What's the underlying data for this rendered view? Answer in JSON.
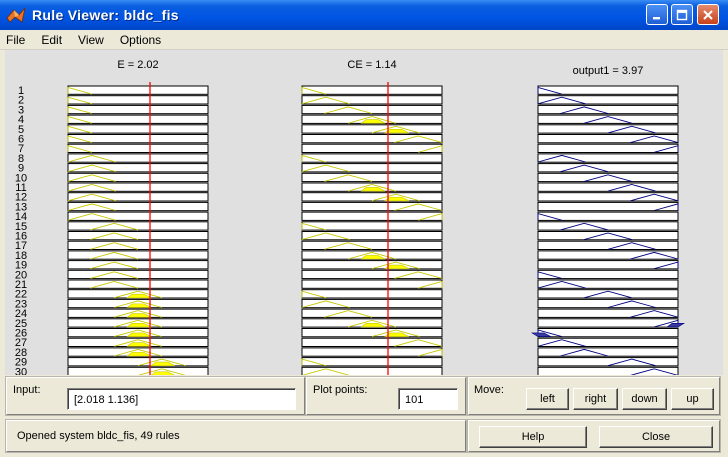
{
  "window": {
    "title": "Rule Viewer: bldc_fis"
  },
  "menu": [
    "File",
    "Edit",
    "View",
    "Options"
  ],
  "plots": {
    "input1_label": "E = 2.02",
    "input2_label": "CE = 1.14",
    "output_label": "output1 = 3.97",
    "rule_numbers": [
      "1",
      "2",
      "3",
      "4",
      "5",
      "6",
      "7",
      "8",
      "9",
      "10",
      "11",
      "12",
      "13",
      "14",
      "15",
      "16",
      "17",
      "18",
      "19",
      "20",
      "21",
      "22",
      "23",
      "24",
      "25",
      "26",
      "27",
      "28",
      "29",
      "30"
    ]
  },
  "input_panel": {
    "label": "Input:",
    "value": "[2.018 1.136]"
  },
  "plot_points": {
    "label": "Plot points:",
    "value": "101"
  },
  "move": {
    "label": "Move:",
    "left": "left",
    "right": "right",
    "down": "down",
    "up": "up"
  },
  "status": {
    "text": "Opened system bldc_fis, 49 rules"
  },
  "buttons": {
    "help": "Help",
    "close": "Close"
  },
  "colors": {
    "title_bar": "#0054e3",
    "input_mf": "#c8c800",
    "fired_fill": "#ffff00",
    "output_mf": "#000080",
    "output_fill": "#3a3aa0",
    "index_line": "#ff0000"
  }
}
